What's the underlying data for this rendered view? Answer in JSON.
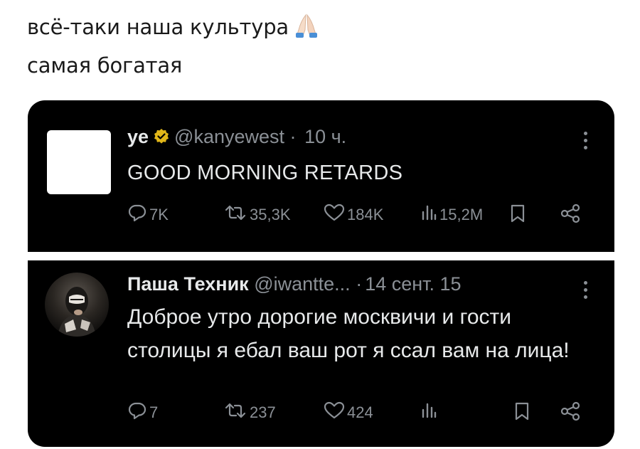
{
  "caption": {
    "line1": "всё-таки наша культура",
    "line2": "самая богатая",
    "emoji_icon": "praying-hands-icon"
  },
  "tweets": [
    {
      "name": "ye",
      "verified": true,
      "handle": "@kanyewest",
      "separator": "·",
      "time": "10 ч.",
      "text": "GOOD MORNING RETARDS",
      "replies": "7K",
      "retweets": "35,3K",
      "likes": "184K",
      "views": "15,2M"
    },
    {
      "name": "Паша Техник",
      "handle": "@iwantte...",
      "separator": "·",
      "time": "14 сент. 15",
      "text": "Доброе утро дорогие москвичи и гости столицы я ебал ваш рот я ссал вам на лица!",
      "replies": "7",
      "retweets": "237",
      "likes": "424"
    }
  ],
  "colors": {
    "tweet_background": "#000000",
    "text_primary": "#e7e9ea",
    "text_secondary": "#8b9096",
    "verified_badge": "#e2b719"
  }
}
